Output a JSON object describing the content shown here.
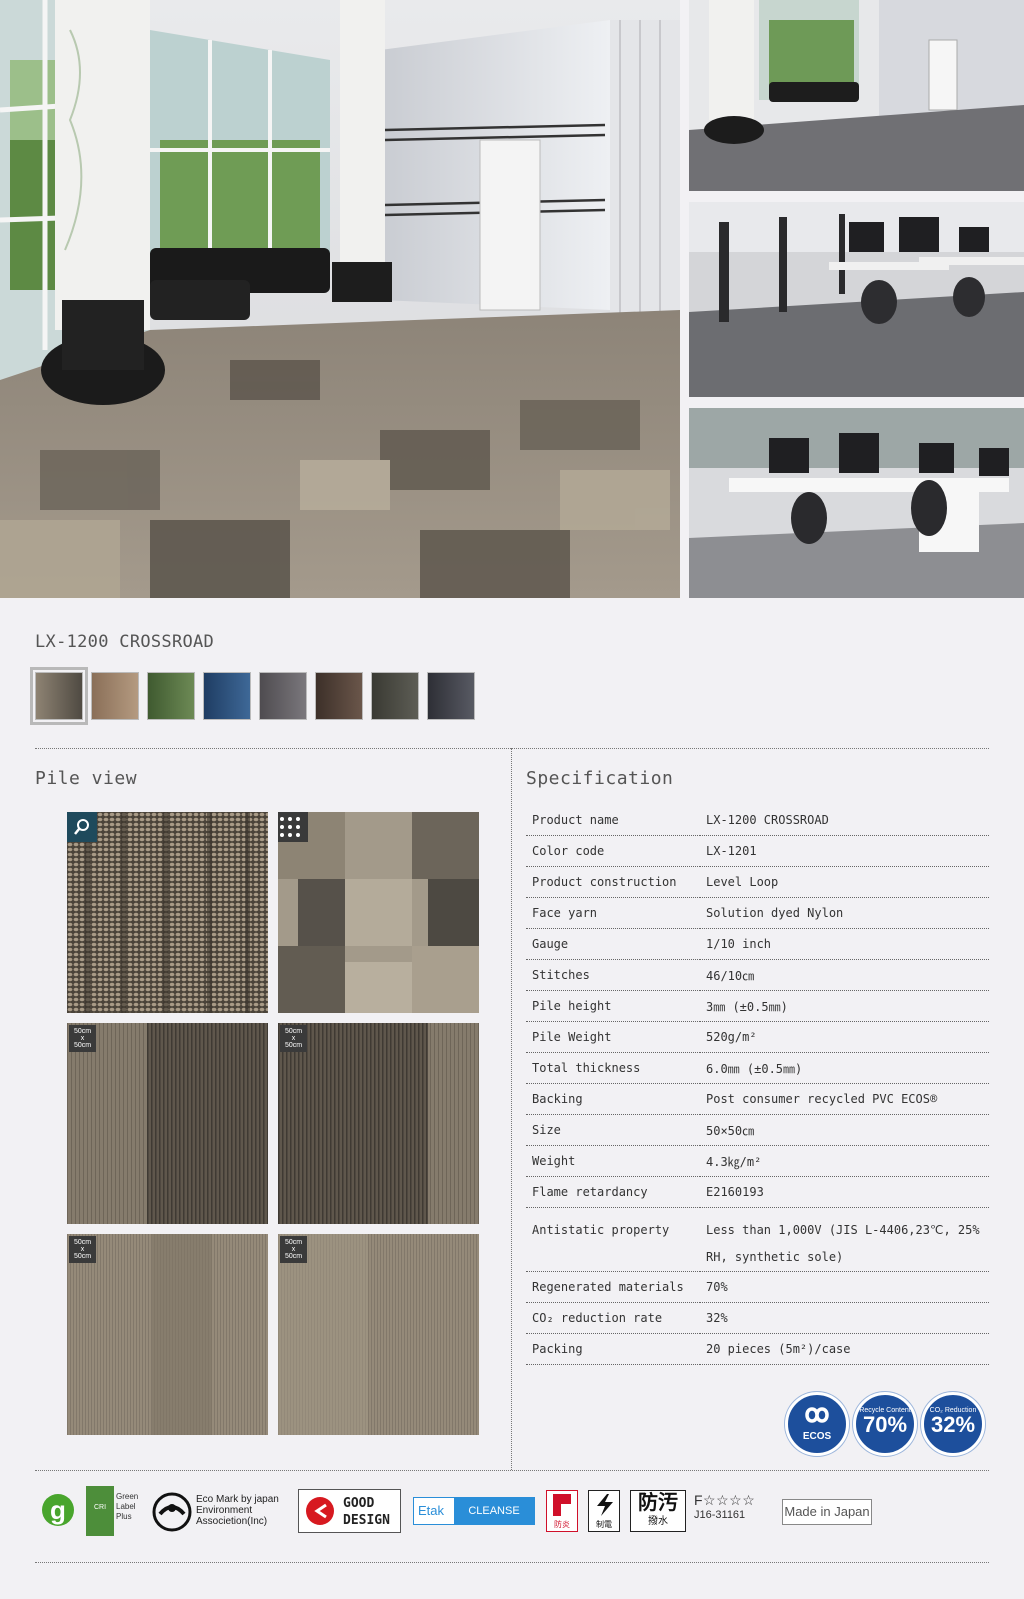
{
  "product": {
    "title": "LX-1200 CROSSROAD"
  },
  "swatches": [
    {
      "color_a": "#8e8373",
      "color_b": "#4f4a42",
      "selected": true
    },
    {
      "color_a": "#8a6f58",
      "color_b": "#b49a80",
      "selected": false
    },
    {
      "color_a": "#3f5a30",
      "color_b": "#6d8a55",
      "selected": false
    },
    {
      "color_a": "#1f3d63",
      "color_b": "#3e6897",
      "selected": false
    },
    {
      "color_a": "#4f4c50",
      "color_b": "#7a777c",
      "selected": false
    },
    {
      "color_a": "#3d3029",
      "color_b": "#6a564a",
      "selected": false
    },
    {
      "color_a": "#3a3a33",
      "color_b": "#5d5d55",
      "selected": false
    },
    {
      "color_a": "#2e2f36",
      "color_b": "#585a63",
      "selected": false
    }
  ],
  "pile_view": {
    "title": "Pile view",
    "tile_badge": {
      "line1": "50cm",
      "line2": "x",
      "line3": "50cm"
    }
  },
  "specification": {
    "title": "Specification",
    "rows": [
      {
        "key": "Product name",
        "value": "LX-1200 CROSSROAD"
      },
      {
        "key": "Color code",
        "value": "LX-1201"
      },
      {
        "key": "Product construction",
        "value": "Level Loop"
      },
      {
        "key": "Face yarn",
        "value": "Solution dyed Nylon"
      },
      {
        "key": "Gauge",
        "value": "1/10 inch"
      },
      {
        "key": "Stitches",
        "value": "46/10㎝"
      },
      {
        "key": "Pile height",
        "value": "3㎜ (±0.5㎜)"
      },
      {
        "key": "Pile Weight",
        "value": "520g/m²"
      },
      {
        "key": "Total thickness",
        "value": "6.0㎜ (±0.5㎜)"
      },
      {
        "key": "Backing",
        "value": "Post consumer recycled PVC ECOS®"
      },
      {
        "key": "Size",
        "value": "50×50㎝"
      },
      {
        "key": "Weight",
        "value": "4.3㎏/m²"
      },
      {
        "key": "Flame retardancy",
        "value": "E2160193"
      },
      {
        "key": "Antistatic property",
        "value": "Less than 1,000V (JIS L-4406,23℃, 25% RH, synthetic sole)"
      },
      {
        "key": "Regenerated materials",
        "value": "70%"
      },
      {
        "key": "CO₂ reduction rate",
        "value": "32%"
      },
      {
        "key": "Packing",
        "value": "20 pieces (5m²)/case"
      }
    ]
  },
  "badges": {
    "ecos": "ECOS",
    "recycle_label": "Recycle Content",
    "recycle_value": "70%",
    "co2_label": "CO₂ Reduction",
    "co2_value": "32%"
  },
  "footer": {
    "cri_lines": [
      "Green",
      "Label",
      "Plus"
    ],
    "cri_mark": "CRI",
    "eco_mark_lines": [
      "Eco Mark by japan",
      "Environment",
      "Associetion(Inc)"
    ],
    "good_design_lines": [
      "GOOD",
      "DESIGN"
    ],
    "etak": "Etak",
    "cleanse": "CLEANSE",
    "kanji_boen": "防炎",
    "kanji_seiden": "制電",
    "bouo": "防汚",
    "hassui": "撥水",
    "fstar": "F☆☆☆☆",
    "fstar_code": "J16-31161",
    "made_in_japan": "Made in Japan"
  },
  "colors": {
    "background": "#f2f1f4",
    "badge_blue": "#1d4f9c",
    "zoom_badge": "#1f4a5c",
    "etak_blue": "#2a8ed8",
    "boen_red": "#d0102a",
    "good_design_red": "#d71920"
  }
}
